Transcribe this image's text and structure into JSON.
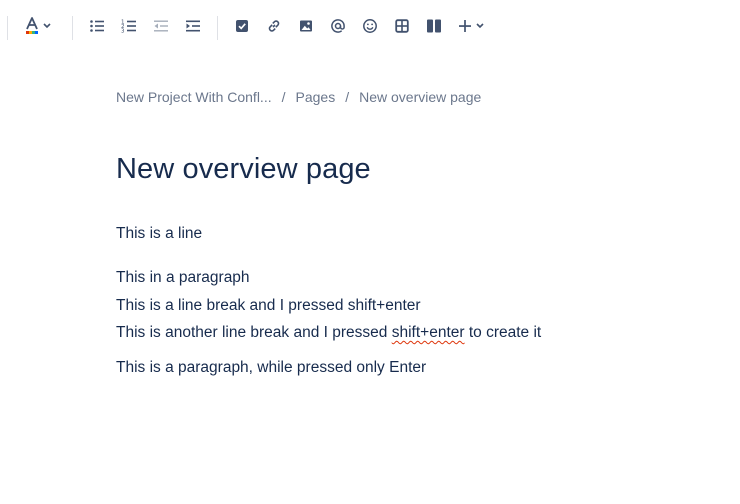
{
  "toolbar": {
    "items": [
      {
        "name": "text-color-icon"
      },
      {
        "name": "bullet-list-icon"
      },
      {
        "name": "numbered-list-icon"
      },
      {
        "name": "outdent-icon"
      },
      {
        "name": "indent-icon"
      },
      {
        "name": "action-item-icon"
      },
      {
        "name": "link-icon"
      },
      {
        "name": "image-icon"
      },
      {
        "name": "mention-icon"
      },
      {
        "name": "emoji-icon"
      },
      {
        "name": "table-icon"
      },
      {
        "name": "layouts-icon"
      },
      {
        "name": "insert-more-icon"
      }
    ]
  },
  "breadcrumb": {
    "items": [
      "New Project With Confl...",
      "Pages",
      "New overview page"
    ],
    "separator": "/"
  },
  "page": {
    "title": "New overview page",
    "line1": "This is a line",
    "para2_line1": "This in a paragraph",
    "para2_line2": "This is a line break and I pressed shift+enter",
    "para2_line3_pre": "This is another line break and I pressed ",
    "para2_line3_misspelled": "shift+enter",
    "para2_line3_post": " to create it",
    "para3": "This is a paragraph, while pressed only Enter"
  },
  "colors": {
    "text": "#172b4d",
    "muted": "#6b778c",
    "icon": "#42526e",
    "spellcheck": "#de350b"
  }
}
